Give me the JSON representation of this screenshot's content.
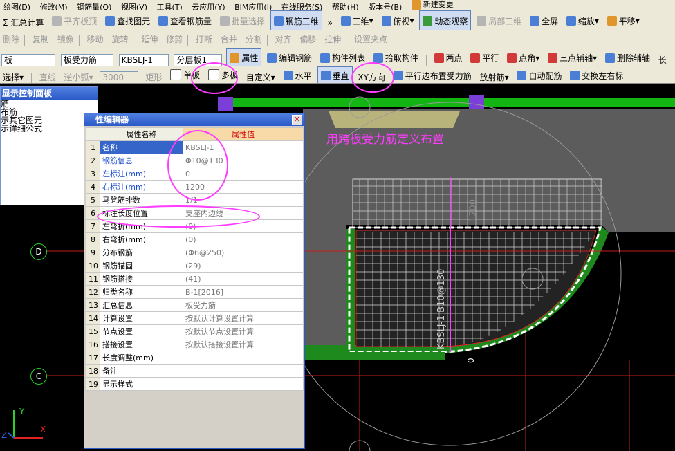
{
  "menubar": [
    "绘图(D)",
    "修改(M)",
    "钢筋量(Q)",
    "视图(V)",
    "工具(T)",
    "云应用(Y)",
    "BIM应用(I)",
    "在线服务(S)",
    "帮助(H)",
    "版本号(B)",
    "新建变更"
  ],
  "toolbar1": {
    "sum_calc": "Σ 汇总计算",
    "align_top": "平齐板顶",
    "find_element": "查找图元",
    "view_rebar_qty": "查看钢筋量",
    "batch_select": "批量选择",
    "rebar_3d": "钢筋三维",
    "three_d": "三维",
    "top_view": "俯视",
    "dynamic_view": "动态观察",
    "local_3d": "局部三维",
    "fullscreen": "全屏",
    "zoom": "缩放",
    "pan": "平移"
  },
  "toolbar2": [
    "删除",
    "复制",
    "镜像",
    "移动",
    "旋转",
    "延伸",
    "修剪",
    "打断",
    "合并",
    "分割",
    "对齐",
    "偏移",
    "拉伸",
    "设置夹点"
  ],
  "toolbar3": {
    "category_value": "板",
    "type_value": "板受力筋",
    "element_value": "KBSLJ-1",
    "layer_value": "分层板1",
    "property_btn": "属性",
    "edit_rebar": "编辑钢筋",
    "element_list": "构件列表",
    "pick_element": "拾取构件",
    "two_points": "两点",
    "parallel": "平行",
    "point_angle": "点角",
    "three_point_axis": "三点辅轴",
    "delete_axis": "删除辅轴",
    "long": "长"
  },
  "toolbar4": {
    "select": "选择",
    "line": "直线",
    "arc": "逆小弧",
    "radius_value": "3000",
    "rect": "矩形",
    "single_slab": "单板",
    "multi_slab": "多板",
    "custom": "自定义",
    "horizontal": "水平",
    "vertical": "垂直",
    "xy_dir": "XY方向",
    "parallel_edge": "平行边布置受力筋",
    "radial": "放射筋",
    "auto_rebar": "自动配筋",
    "swap_marks": "交换左右标"
  },
  "display_panel": {
    "title": "显示控制面板",
    "items": [
      "筋",
      "布筋",
      "示其它图元",
      "示详细公式"
    ]
  },
  "property_editor": {
    "title": "性编辑器",
    "col_name": "属性名称",
    "col_value": "属性值",
    "rows": [
      {
        "num": "1",
        "name": "名称",
        "value": "KBSLJ-1"
      },
      {
        "num": "2",
        "name": "钢筋信息",
        "value": "Φ10@130"
      },
      {
        "num": "3",
        "name": "左标注(mm)",
        "value": "0"
      },
      {
        "num": "4",
        "name": "右标注(mm)",
        "value": "1200"
      },
      {
        "num": "5",
        "name": "马凳筋排数",
        "value": "1/1"
      },
      {
        "num": "6",
        "name": "标注长度位置",
        "value": "支座内边线"
      },
      {
        "num": "7",
        "name": "左弯折(mm)",
        "value": "(0)"
      },
      {
        "num": "8",
        "name": "右弯折(mm)",
        "value": "(0)"
      },
      {
        "num": "9",
        "name": "分布钢筋",
        "value": "(Φ6@250)"
      },
      {
        "num": "10",
        "name": "钢筋锚固",
        "value": "(29)"
      },
      {
        "num": "11",
        "name": "钢筋搭接",
        "value": "(41)"
      },
      {
        "num": "12",
        "name": "归类名称",
        "value": "B-1[2016]"
      },
      {
        "num": "13",
        "name": "汇总信息",
        "value": "板受力筋"
      },
      {
        "num": "14",
        "name": "计算设置",
        "value": "按默认计算设置计算"
      },
      {
        "num": "15",
        "name": "节点设置",
        "value": "按默认节点设置计算"
      },
      {
        "num": "16",
        "name": "搭接设置",
        "value": "按默认搭接设置计算"
      },
      {
        "num": "17",
        "name": "长度调整(mm)",
        "value": ""
      },
      {
        "num": "18",
        "name": "备注",
        "value": ""
      },
      {
        "num": "19",
        "name": "显示样式",
        "value": ""
      }
    ]
  },
  "canvas": {
    "annotation": "用跨板受力筋定义布置",
    "rebar_label": "KBSLJ-1 B10@130",
    "dim_1200": "1200",
    "dim_0": "0",
    "axis_d": "D",
    "axis_c": "C",
    "axis_x": "X",
    "axis_y": "Y",
    "axis_z": "Z"
  },
  "colors": {
    "highlight": "#ff3cff",
    "slab_green": "#1e8a1e",
    "canvas_bg": "#000000",
    "slab_gray": "#5c5c5c"
  }
}
